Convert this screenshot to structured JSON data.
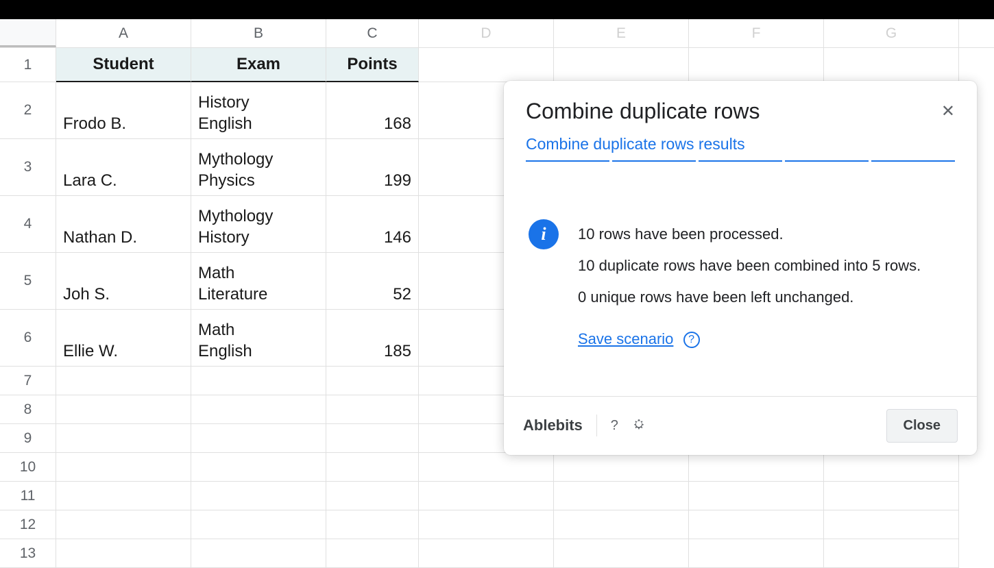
{
  "columns": [
    "A",
    "B",
    "C",
    "D",
    "E",
    "F",
    "G"
  ],
  "headers": {
    "a": "Student",
    "b": "Exam",
    "c": "Points"
  },
  "rows": [
    {
      "n": "1"
    },
    {
      "n": "2",
      "student": "Frodo B.",
      "exam": "History\nEnglish",
      "points": "168"
    },
    {
      "n": "3",
      "student": "Lara C.",
      "exam": "Mythology\nPhysics",
      "points": "199"
    },
    {
      "n": "4",
      "student": "Nathan D.",
      "exam": "Mythology\nHistory",
      "points": "146"
    },
    {
      "n": "5",
      "student": "Joh S.",
      "exam": "Math\nLiterature",
      "points": "52"
    },
    {
      "n": "6",
      "student": "Ellie W.",
      "exam": "Math\nEnglish",
      "points": "185"
    },
    {
      "n": "7"
    },
    {
      "n": "8"
    },
    {
      "n": "9"
    },
    {
      "n": "10"
    },
    {
      "n": "11"
    },
    {
      "n": "12"
    },
    {
      "n": "13"
    }
  ],
  "dialog": {
    "title": "Combine duplicate rows",
    "tab": "Combine duplicate rows results",
    "messages": {
      "line1": "10 rows have been processed.",
      "line2": "10 duplicate rows have been combined into 5 rows.",
      "line3": "0 unique rows have been left unchanged."
    },
    "save_label": "Save scenario",
    "brand": "Ablebits",
    "help_symbol": "?",
    "bug_symbol": "🐞",
    "close_label": "Close",
    "close_x": "✕"
  }
}
